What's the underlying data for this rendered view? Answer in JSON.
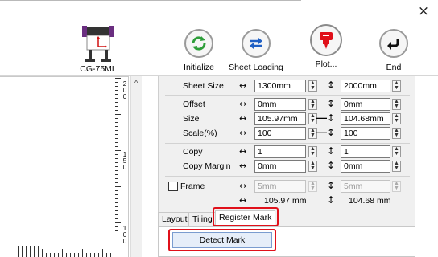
{
  "window": {
    "close_glyph": "×"
  },
  "device": {
    "label": "CG-75ML",
    "icon": "plotter-icon"
  },
  "toolbar": {
    "initialize": {
      "label": "Initialize",
      "icon": "refresh-icon",
      "color": "#2e9e3a"
    },
    "sheet_loading": {
      "label": "Sheet Loading",
      "icon": "swap-icon",
      "color": "#1f5fc4"
    },
    "plot": {
      "label": "Plot...",
      "icon": "cutter-icon",
      "color": "#e0101a"
    },
    "end": {
      "label": "End",
      "icon": "return-icon",
      "color": "#1a1a1a"
    }
  },
  "ruler": {
    "vertical_numbers": [
      "2",
      "0",
      "0",
      "1",
      "5",
      "0",
      "1",
      "0",
      "0"
    ],
    "scroll_up_glyph": "^"
  },
  "settings": {
    "sheet_size": {
      "label": "Sheet Size",
      "width": "1300mm",
      "height": "2000mm"
    },
    "offset": {
      "label": "Offset",
      "x": "0mm",
      "y": "0mm"
    },
    "size": {
      "label": "Size",
      "width": "105.97mm",
      "height": "104.68mm"
    },
    "scale": {
      "label": "Scale(%)",
      "x": "100",
      "y": "100"
    },
    "copy": {
      "label": "Copy",
      "x": "1",
      "y": "1"
    },
    "copy_margin": {
      "label": "Copy Margin",
      "x": "0mm",
      "y": "0mm"
    },
    "frame": {
      "label": "Frame",
      "checked": false,
      "x": "5mm",
      "y": "5mm"
    },
    "result": {
      "width": "105.97 mm",
      "height": "104.68 mm"
    },
    "h_arrow": "↔",
    "v_arrow": "↕",
    "dash": "—",
    "spin_up": "▲",
    "spin_down": "▼"
  },
  "tabs": [
    {
      "label": "Layout",
      "active": false
    },
    {
      "label": "Tiling",
      "active": false
    },
    {
      "label": "Register Mark",
      "active": true
    }
  ],
  "register_mark": {
    "detect_button": "Detect Mark"
  },
  "highlight_color": "#e0101a"
}
